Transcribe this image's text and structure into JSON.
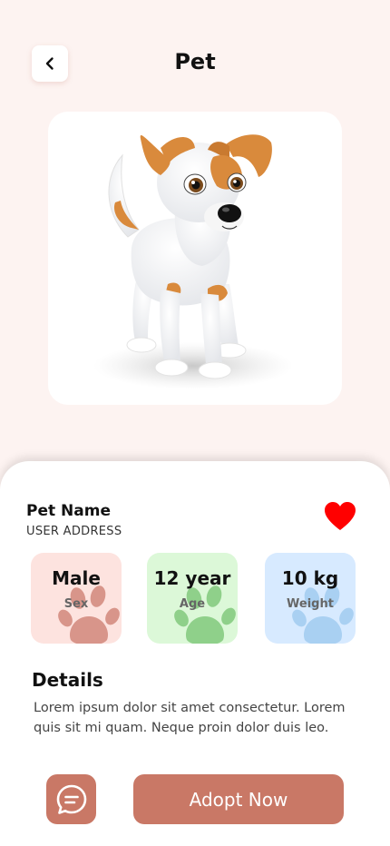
{
  "header": {
    "title": "Pet",
    "back_icon": "chevron-left-icon"
  },
  "pet": {
    "image": "cartoon-dog-image",
    "name": "Pet Name",
    "address": "USER ADDRESS",
    "favorite_icon": "heart-icon",
    "favorite_color": "#ff0000"
  },
  "stats": [
    {
      "value": "Male",
      "label": "Sex",
      "bg": "#fde3df",
      "paw": "#d8958a"
    },
    {
      "value": "12 year",
      "label": "Age",
      "bg": "#dcf8d8",
      "paw": "#8fd08a"
    },
    {
      "value": "10 kg",
      "label": "Weight",
      "bg": "#d7eaff",
      "paw": "#a9d0f2"
    }
  ],
  "details": {
    "heading": "Details",
    "text": "Lorem ipsum dolor sit amet consectetur. Lorem quis sit mi quam. Neque proin dolor duis leo."
  },
  "actions": {
    "chat_icon": "chat-icon",
    "adopt_label": "Adopt Now",
    "accent": "#c97866"
  }
}
